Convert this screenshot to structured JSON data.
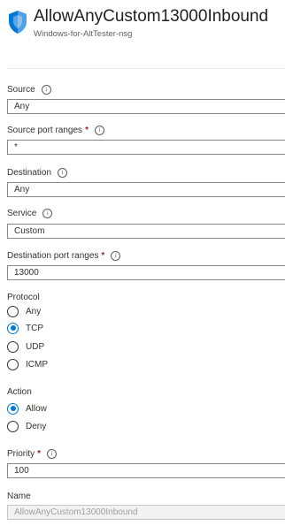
{
  "header": {
    "title": "AllowAnyCustom13000Inbound",
    "subtitle": "Windows-for-AltTester-nsg",
    "icon": "shield-icon",
    "accent": "#0078d4"
  },
  "fields": {
    "source": {
      "label": "Source",
      "value": "Any"
    },
    "source_port_ranges": {
      "label": "Source port ranges",
      "required_mark": "*",
      "value": "*"
    },
    "destination": {
      "label": "Destination",
      "value": "Any"
    },
    "service": {
      "label": "Service",
      "value": "Custom"
    },
    "destination_port_ranges": {
      "label": "Destination port ranges",
      "required_mark": "*",
      "value": "13000"
    },
    "protocol": {
      "label": "Protocol",
      "options": [
        "Any",
        "TCP",
        "UDP",
        "ICMP"
      ],
      "selected": "TCP"
    },
    "action": {
      "label": "Action",
      "options": [
        "Allow",
        "Deny"
      ],
      "selected": "Allow"
    },
    "priority": {
      "label": "Priority",
      "required_mark": "*",
      "value": "100"
    },
    "name": {
      "label": "Name",
      "value": "AllowAnyCustom13000Inbound"
    }
  },
  "info_glyph": "i"
}
